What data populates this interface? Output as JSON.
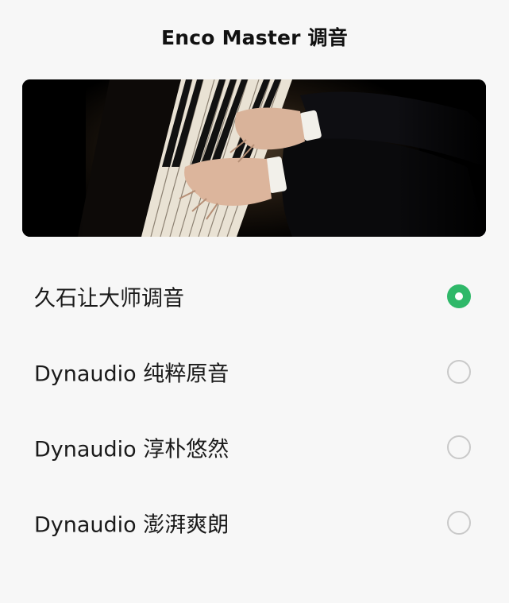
{
  "header": {
    "title": "Enco Master 调音"
  },
  "banner": {
    "image": "piano-hands-photo"
  },
  "options": [
    {
      "label": "久石让大师调音",
      "selected": true
    },
    {
      "label": "Dynaudio 纯粹原音",
      "selected": false
    },
    {
      "label": "Dynaudio 淳朴悠然",
      "selected": false
    },
    {
      "label": "Dynaudio 澎湃爽朗",
      "selected": false
    }
  ],
  "colors": {
    "accent": "#2fb869",
    "radio_border": "#c9c9c9",
    "background": "#f7f7f7"
  }
}
